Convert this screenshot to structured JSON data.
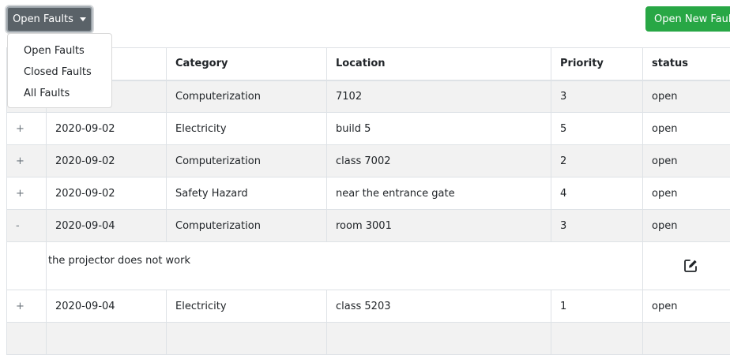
{
  "toolbar": {
    "filter_label": "Open Faults",
    "new_fault_label": "Open New Fault"
  },
  "dropdown": {
    "items": [
      "Open Faults",
      "Closed Faults",
      "All Faults"
    ]
  },
  "table": {
    "headers": [
      "Category",
      "Location",
      "Priority",
      "status"
    ],
    "rows": [
      {
        "toggle": "",
        "date": "",
        "category": "Computerization",
        "location": "7102",
        "priority": "3",
        "status": "open"
      },
      {
        "toggle": "+",
        "date": "2020-09-02",
        "category": "Electricity",
        "location": "build 5",
        "priority": "5",
        "status": "open"
      },
      {
        "toggle": "+",
        "date": "2020-09-02",
        "category": "Computerization",
        "location": "class 7002",
        "priority": "2",
        "status": "open"
      },
      {
        "toggle": "+",
        "date": "2020-09-02",
        "category": "Safety Hazard",
        "location": "near the entrance gate",
        "priority": "4",
        "status": "open"
      },
      {
        "toggle": "-",
        "date": "2020-09-04",
        "category": "Computerization",
        "location": "room 3001",
        "priority": "3",
        "status": "open"
      },
      {
        "toggle": "+",
        "date": "2020-09-04",
        "category": "Electricity",
        "location": "class 5203",
        "priority": "1",
        "status": "open"
      }
    ],
    "expanded_description": "the projector does not work"
  },
  "colors": {
    "primary_button": "#5a6268",
    "success_button": "#28a745",
    "row_stripe": "#f2f2f2"
  },
  "icons": {
    "edit": "edit-square-icon",
    "caret": "caret-down-icon"
  }
}
